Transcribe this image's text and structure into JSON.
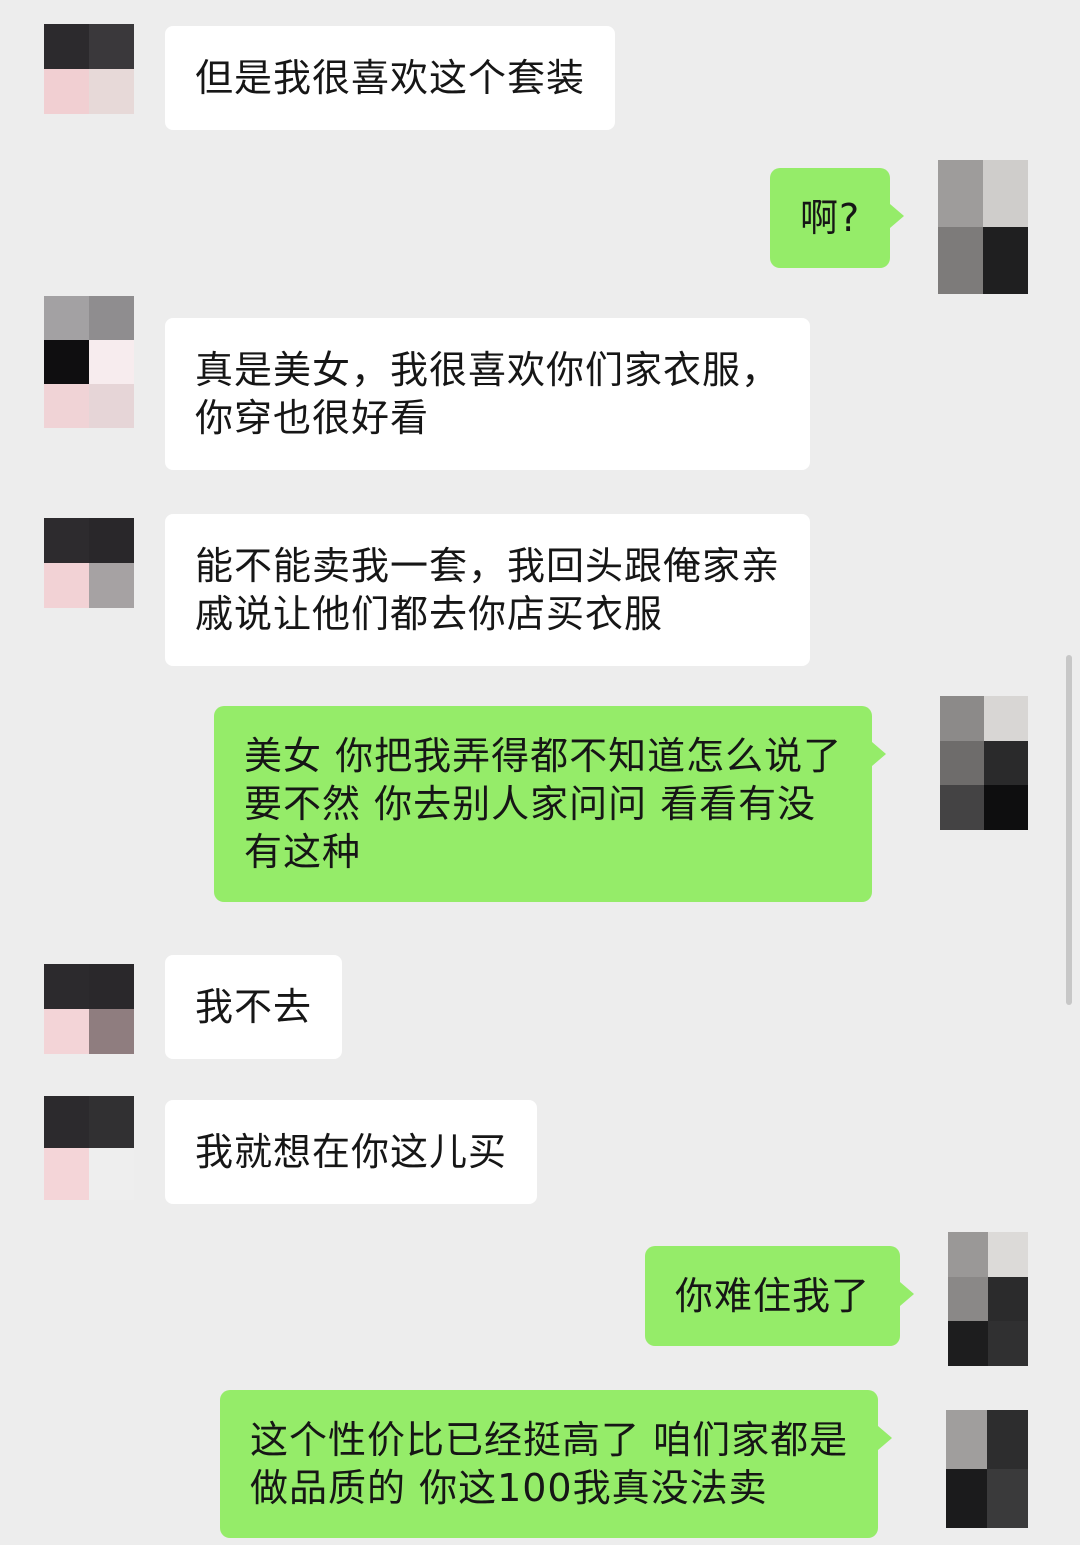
{
  "colors": {
    "background": "#ededed",
    "incoming_bubble": "#ffffff",
    "outgoing_bubble": "#95ec69"
  },
  "messages": [
    {
      "side": "in",
      "text": "但是我很喜欢这个套装"
    },
    {
      "side": "out",
      "text": "啊?"
    },
    {
      "side": "in",
      "text": "真是美女，我很喜欢你们家衣服，\n你穿也很好看"
    },
    {
      "side": "in",
      "text": "能不能卖我一套，我回头跟俺家亲\n戚说让他们都去你店买衣服"
    },
    {
      "side": "out",
      "text": "美女 你把我弄得都不知道怎么说了\n要不然 你去别人家问问 看看有没\n有这种"
    },
    {
      "side": "in",
      "text": "我不去"
    },
    {
      "side": "in",
      "text": "我就想在你这儿买"
    },
    {
      "side": "out",
      "text": "你难住我了"
    },
    {
      "side": "out",
      "text": "这个性价比已经挺高了 咱们家都是\n做品质的 你这100我真没法卖"
    }
  ]
}
